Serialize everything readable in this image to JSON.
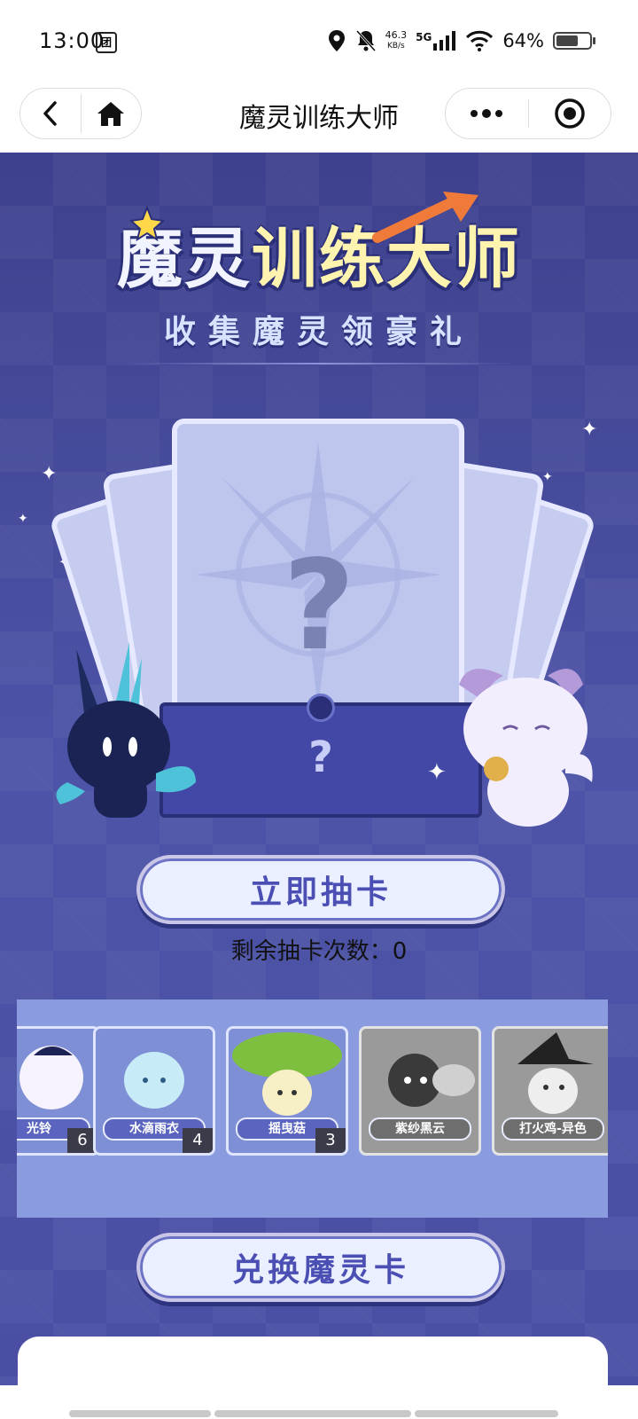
{
  "status_bar": {
    "time": "13:00",
    "sim_icon": "sim-card-icon",
    "net_speed": "46.3",
    "net_unit": "KB/s",
    "network": "5G",
    "battery_pct": "64%"
  },
  "nav": {
    "title": "魔灵训练大师",
    "back_icon": "back-arrow-icon",
    "home_icon": "home-icon",
    "more_icon": "more-dots-icon",
    "close_icon": "target-close-icon"
  },
  "banner": {
    "title_left": "魔灵",
    "title_right": "训练大师",
    "subtitle": "收集魔灵领豪礼"
  },
  "draw": {
    "card_mark": "?",
    "envelope_mark": "?",
    "draw_button": "立即抽卡",
    "remaining_text": "剩余抽卡次数：0"
  },
  "collection": [
    {
      "name": "光铃",
      "count": "6",
      "owned": true
    },
    {
      "name": "水滴雨衣",
      "count": "4",
      "owned": true
    },
    {
      "name": "摇曳菇",
      "count": "3",
      "owned": true
    },
    {
      "name": "紫纱黑云",
      "count": "",
      "owned": false
    },
    {
      "name": "打火鸡-异色",
      "count": "",
      "owned": false
    }
  ],
  "exchange_button": "兑换魔灵卡",
  "colors": {
    "bg": "#4a4fa4",
    "strip": "#8a9be0",
    "button_text": "#4b4fb3"
  }
}
